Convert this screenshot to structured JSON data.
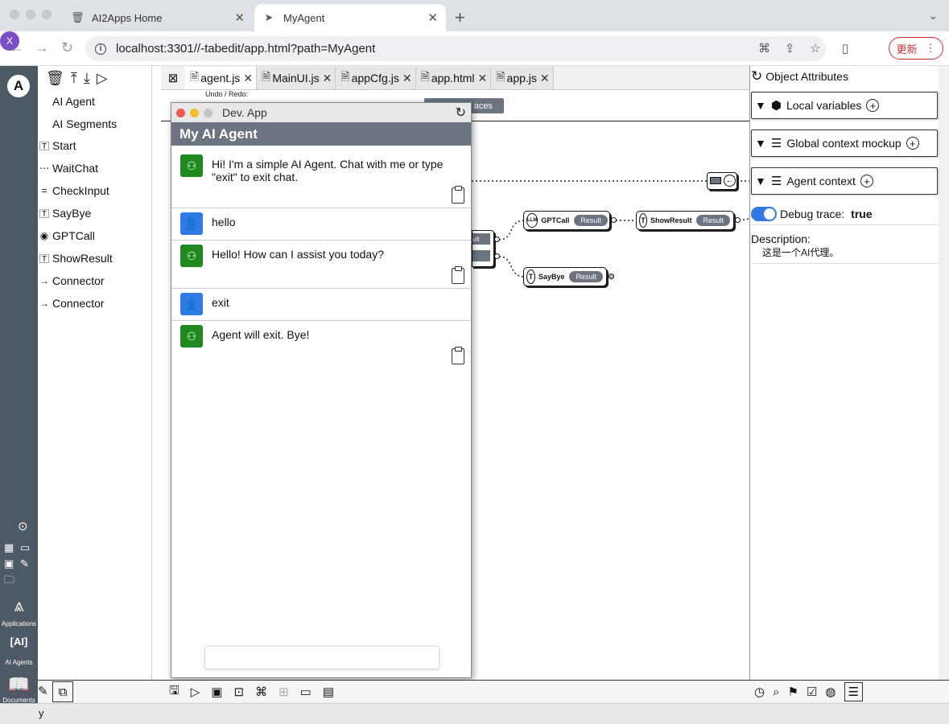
{
  "browser": {
    "tabs": [
      {
        "title": "AI2Apps Home",
        "icon": "trash-icon"
      },
      {
        "title": "MyAgent",
        "icon": "paper-plane-icon"
      }
    ],
    "url": "localhost:3301//-tabedit/app.html?path=MyAgent",
    "profile_initial": "X",
    "update_label": "更新"
  },
  "leftnav": {
    "logo": "A",
    "items": [
      {
        "label": "Applications",
        "icon": "app-store-icon"
      },
      {
        "label": "AI Agents",
        "icon": "ai-agents-icon"
      },
      {
        "label": "Documents",
        "icon": "book-icon"
      }
    ],
    "status_fragment": "y"
  },
  "components": {
    "items": [
      {
        "label": "AI Agent",
        "icon": "agent-icon"
      },
      {
        "label": "AI Segments",
        "icon": "segments-icon"
      },
      {
        "label": "Start",
        "icon": "text-icon"
      },
      {
        "label": "WaitChat",
        "icon": "chat-icon"
      },
      {
        "label": "CheckInput",
        "icon": "equals-icon"
      },
      {
        "label": "SayBye",
        "icon": "text-icon"
      },
      {
        "label": "GPTCall",
        "icon": "llm-icon"
      },
      {
        "label": "ShowResult",
        "icon": "text-icon"
      },
      {
        "label": "Connector",
        "icon": "arrow-right-icon"
      },
      {
        "label": "Connector",
        "icon": "arrow-right-icon"
      }
    ]
  },
  "editor": {
    "tabs": [
      {
        "label": "agent.js"
      },
      {
        "label": "MainUI.js"
      },
      {
        "label": "appCfg.js"
      },
      {
        "label": "app.html"
      },
      {
        "label": "app.js"
      }
    ],
    "undo_label": "Undo / Redo:",
    "traces_fragment": "aces",
    "nodes": {
      "gptcall": "GPTCall",
      "showresult": "ShowResult",
      "saybye": "SayBye",
      "result": "Result",
      "partial_result": "ult",
      "llm_icon": "LLM"
    }
  },
  "devapp": {
    "title": "Dev. App",
    "header": "My AI Agent",
    "messages": [
      {
        "role": "bot",
        "text": "Hi! I'm a simple AI Agent. Chat with me or type \"exit\" to exit chat."
      },
      {
        "role": "user",
        "text": "hello"
      },
      {
        "role": "bot",
        "text": "Hello! How can I assist you today?"
      },
      {
        "role": "user",
        "text": "exit"
      },
      {
        "role": "bot",
        "text": "Agent will exit. Bye!"
      }
    ],
    "input_value": ""
  },
  "attributes": {
    "title": "Object Attributes",
    "sections": [
      {
        "label": "Local variables",
        "icon": "cube-icon"
      },
      {
        "label": "Global context mockup",
        "icon": "database-icon"
      },
      {
        "label": "Agent context",
        "icon": "database-icon"
      }
    ],
    "debug_label": "Debug trace:",
    "debug_value": "true",
    "description_label": "Description:",
    "description_value": "这是一个AI代理。"
  },
  "colors": {
    "nav_bg": "#4d5a66",
    "header_bg": "#6b7480",
    "bot_avatar": "#1e8a1e",
    "user_avatar": "#2f7ae5",
    "toggle_on": "#2f7ae5",
    "update_button": "#c9302c"
  }
}
